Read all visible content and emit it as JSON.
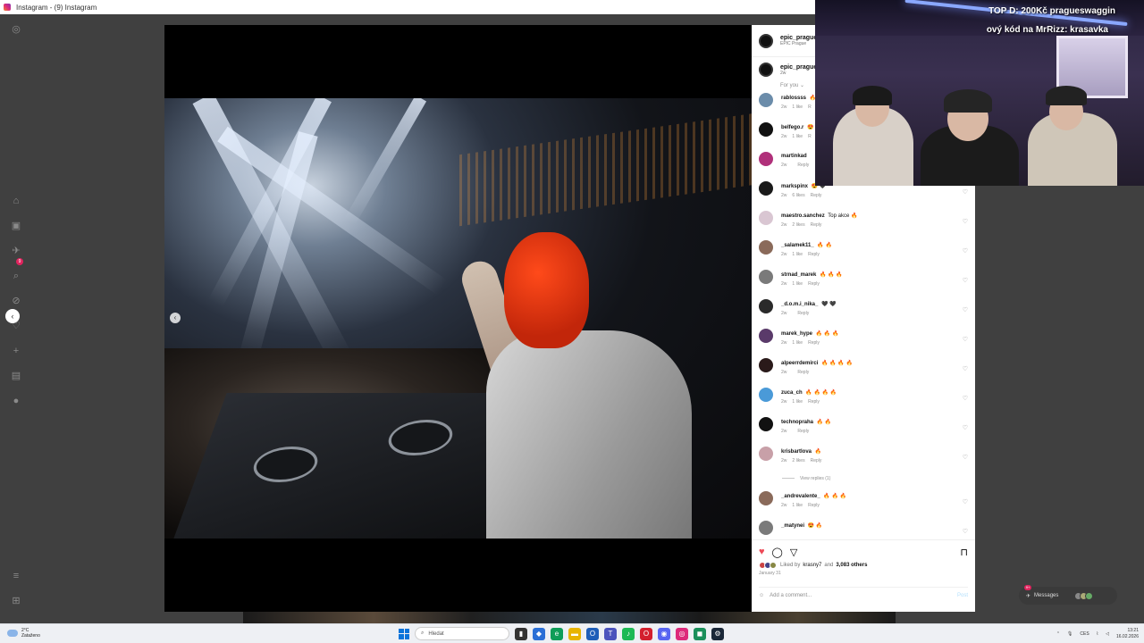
{
  "window": {
    "title": "Instagram - (9) Instagram"
  },
  "nav": {
    "notifications_badge": "9"
  },
  "post": {
    "author": "epic_prague",
    "location": "EPIC Prague",
    "caption_author": "epic_prague",
    "caption_time": "2w",
    "for_you": "For you ⌄",
    "carousel_dot_count": 16,
    "carousel_active_index": 15,
    "liked_by_prefix": "Liked by",
    "liked_by_user": "krasny7",
    "liked_by_suffix": "and",
    "likes_count": "3,083 others",
    "date": "January 31",
    "add_comment_placeholder": "Add a comment...",
    "post_button": "Post"
  },
  "comments": [
    {
      "user": "rablossss",
      "text": "🔥",
      "time": "2w",
      "likes": "1 like",
      "reply": "R"
    },
    {
      "user": "belfego.r",
      "text": "😍",
      "time": "2w",
      "likes": "1 like",
      "reply": "R"
    },
    {
      "user": "martinkad",
      "text": "",
      "time": "2w",
      "likes": "",
      "reply": "Reply"
    },
    {
      "user": "markspinx",
      "text": "😍 🖤",
      "time": "2w",
      "likes": "6 likes",
      "reply": "Reply"
    },
    {
      "user": "maestro.sanchez",
      "text": "Top akce 🔥",
      "time": "2w",
      "likes": "2 likes",
      "reply": "Reply"
    },
    {
      "user": "_salamek11_",
      "text": "🔥 🔥",
      "time": "2w",
      "likes": "1 like",
      "reply": "Reply"
    },
    {
      "user": "strnad_marek",
      "text": "🔥 🔥 🔥",
      "time": "2w",
      "likes": "1 like",
      "reply": "Reply"
    },
    {
      "user": "_d.o.m.i_nika_",
      "text": "🖤 🖤",
      "time": "2w",
      "likes": "",
      "reply": "Reply"
    },
    {
      "user": "marek_hype",
      "text": "🔥 🔥 🔥",
      "time": "2w",
      "likes": "1 like",
      "reply": "Reply"
    },
    {
      "user": "alpeerrdemirci",
      "text": "🔥 🔥 🔥 🔥",
      "time": "2w",
      "likes": "",
      "reply": "Reply"
    },
    {
      "user": "zuca_ch",
      "text": "🔥 🔥 🔥 🔥",
      "time": "2w",
      "likes": "1 like",
      "reply": "Reply"
    },
    {
      "user": "technopraha",
      "text": "🔥 🔥",
      "time": "2w",
      "likes": "",
      "reply": "Reply"
    },
    {
      "user": "krisbartlova",
      "text": "🔥",
      "time": "2w",
      "likes": "2 likes",
      "reply": "Reply"
    }
  ],
  "view_replies": "View replies (1)",
  "comments_more": [
    {
      "user": "_andrevalente_",
      "text": "🔥 🔥 🔥",
      "time": "2w",
      "likes": "1 like",
      "reply": "Reply"
    },
    {
      "user": "_matynei",
      "text": "😍 🔥",
      "time": "",
      "likes": "",
      "reply": ""
    }
  ],
  "messages": {
    "label": "Messages",
    "badge": "9+"
  },
  "webcam": {
    "overlay_line1": "TOP D: 200Kč pragueswaggin",
    "overlay_line2": "ový kód na MrRizz: krasavka"
  },
  "taskbar": {
    "weather_temp": "2°C",
    "weather_desc": "Zataženo",
    "search_placeholder": "Hledat",
    "language": "CES",
    "time": "13:21",
    "date": "16.02.2026"
  },
  "colors": {
    "heart_red": "#ed4956",
    "link_blue": "#0095f6",
    "accent_orange": "#ff4a1a"
  }
}
